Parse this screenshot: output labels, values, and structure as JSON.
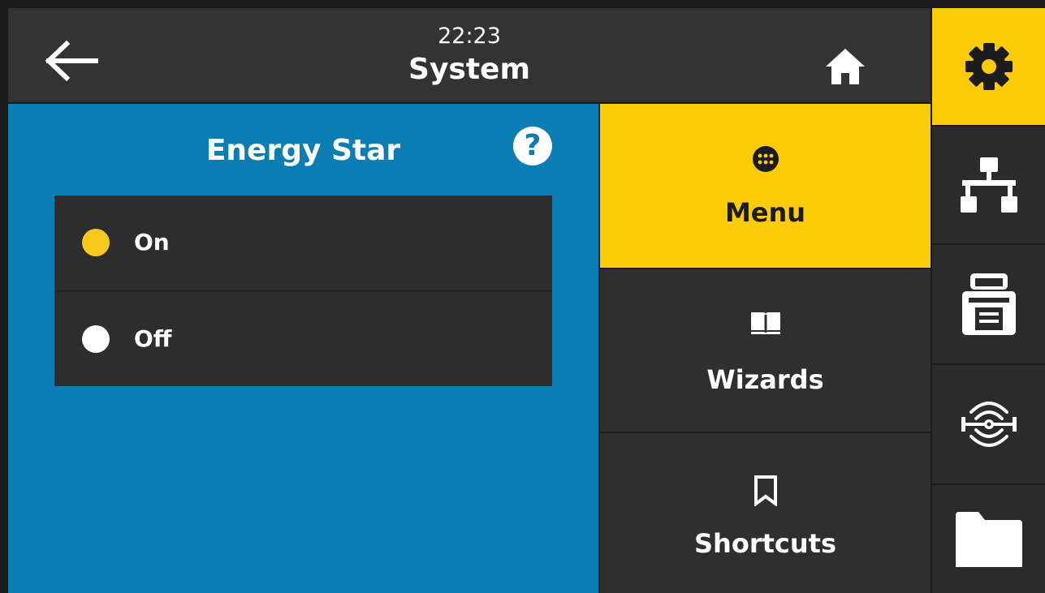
{
  "header": {
    "time": "22:23",
    "title": "System",
    "back_icon": "arrow-left-icon",
    "home_icon": "home-icon"
  },
  "panel": {
    "title": "Energy Star",
    "help_label": "?",
    "options": [
      {
        "label": "On",
        "selected": true
      },
      {
        "label": "Off",
        "selected": false
      }
    ]
  },
  "nav": {
    "items": [
      {
        "label": "Menu",
        "icon": "grid-dots-icon",
        "active": true
      },
      {
        "label": "Wizards",
        "icon": "book-icon",
        "active": false
      },
      {
        "label": "Shortcuts",
        "icon": "bookmark-icon",
        "active": false
      }
    ]
  },
  "rail": {
    "items": [
      {
        "icon": "gear-icon",
        "active": true
      },
      {
        "icon": "network-icon",
        "active": false
      },
      {
        "icon": "printer-icon",
        "active": false
      },
      {
        "icon": "rfid-icon",
        "active": false
      },
      {
        "icon": "folder-icon",
        "active": false
      }
    ]
  },
  "colors": {
    "accent_yellow": "#fccc08",
    "panel_blue": "#0a7db3",
    "dark": "#2f2f2f",
    "radio_selected": "#f8c91a"
  }
}
